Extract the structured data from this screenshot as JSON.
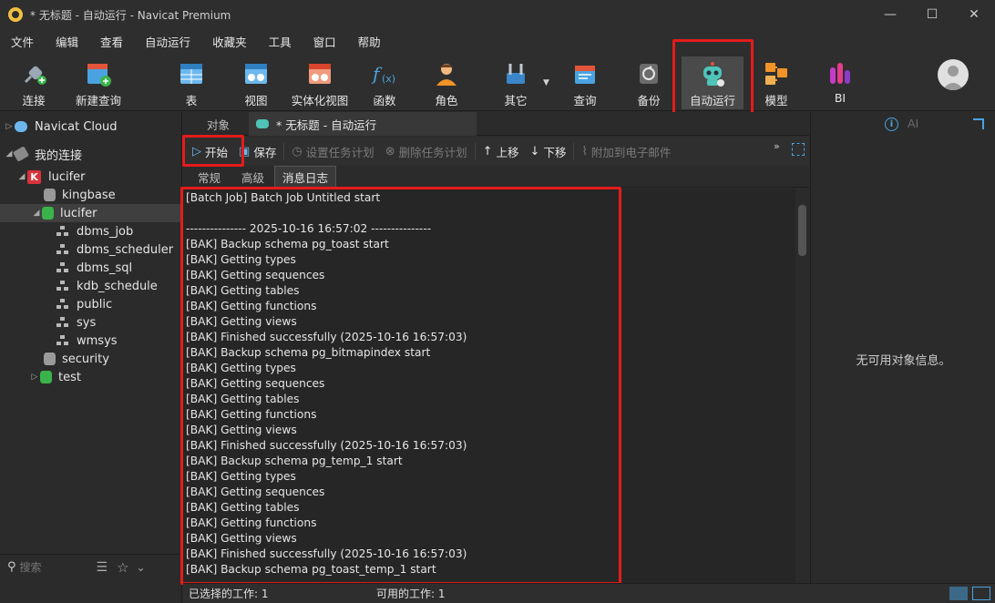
{
  "window": {
    "title": "* 无标题 - 自动运行 - Navicat Premium",
    "minimize": "—",
    "maximize": "☐",
    "close": "✕"
  },
  "menu": [
    "文件",
    "编辑",
    "查看",
    "自动运行",
    "收藏夹",
    "工具",
    "窗口",
    "帮助"
  ],
  "toolbar": {
    "connect": "连接",
    "new_query": "新建查询",
    "table": "表",
    "view": "视图",
    "mat_view": "实体化视图",
    "function": "函数",
    "role": "角色",
    "other": "其它",
    "query": "查询",
    "backup": "备份",
    "automation": "自动运行",
    "model": "模型",
    "bi": "BI"
  },
  "tree": {
    "navicat_cloud": "Navicat Cloud",
    "my_connections": "我的连接",
    "connection": "lucifer",
    "databases": {
      "kingbase": "kingbase",
      "lucifer": "lucifer",
      "security": "security",
      "test": "test"
    },
    "schemas": [
      "dbms_job",
      "dbms_scheduler",
      "dbms_sql",
      "kdb_schedule",
      "public",
      "sys",
      "wmsys"
    ]
  },
  "search": {
    "placeholder": "搜索"
  },
  "tabs": {
    "objects": "对象",
    "editor": "* 无标题 - 自动运行"
  },
  "job_toolbar": {
    "start": "开始",
    "save": "保存",
    "set_schedule": "设置任务计划",
    "delete_schedule": "删除任务计划",
    "move_up": "上移",
    "move_down": "下移",
    "attach_email": "附加到电子邮件"
  },
  "subtabs": [
    "常规",
    "高级",
    "消息日志"
  ],
  "log": [
    "[Batch Job] Batch Job Untitled start",
    "",
    "--------------- 2025-10-16 16:57:02 ---------------",
    "[BAK] Backup schema pg_toast start",
    "[BAK] Getting types",
    "[BAK] Getting sequences",
    "[BAK] Getting tables",
    "[BAK] Getting functions",
    "[BAK] Getting views",
    "[BAK] Finished successfully (2025-10-16 16:57:03)",
    "[BAK] Backup schema pg_bitmapindex start",
    "[BAK] Getting types",
    "[BAK] Getting sequences",
    "[BAK] Getting tables",
    "[BAK] Getting functions",
    "[BAK] Getting views",
    "[BAK] Finished successfully (2025-10-16 16:57:03)",
    "[BAK] Backup schema pg_temp_1 start",
    "[BAK] Getting types",
    "[BAK] Getting sequences",
    "[BAK] Getting tables",
    "[BAK] Getting functions",
    "[BAK] Getting views",
    "[BAK] Finished successfully (2025-10-16 16:57:03)",
    "[BAK] Backup schema pg_toast_temp_1 start"
  ],
  "right_panel": {
    "ai_label": "AI",
    "empty_message": "无可用对象信息。"
  },
  "status": {
    "selected_jobs": "已选择的工作: 1",
    "available_jobs": "可用的工作: 1"
  },
  "colors": {
    "highlight_red": "#e51b1b",
    "accent_blue": "#4aa3e0"
  }
}
